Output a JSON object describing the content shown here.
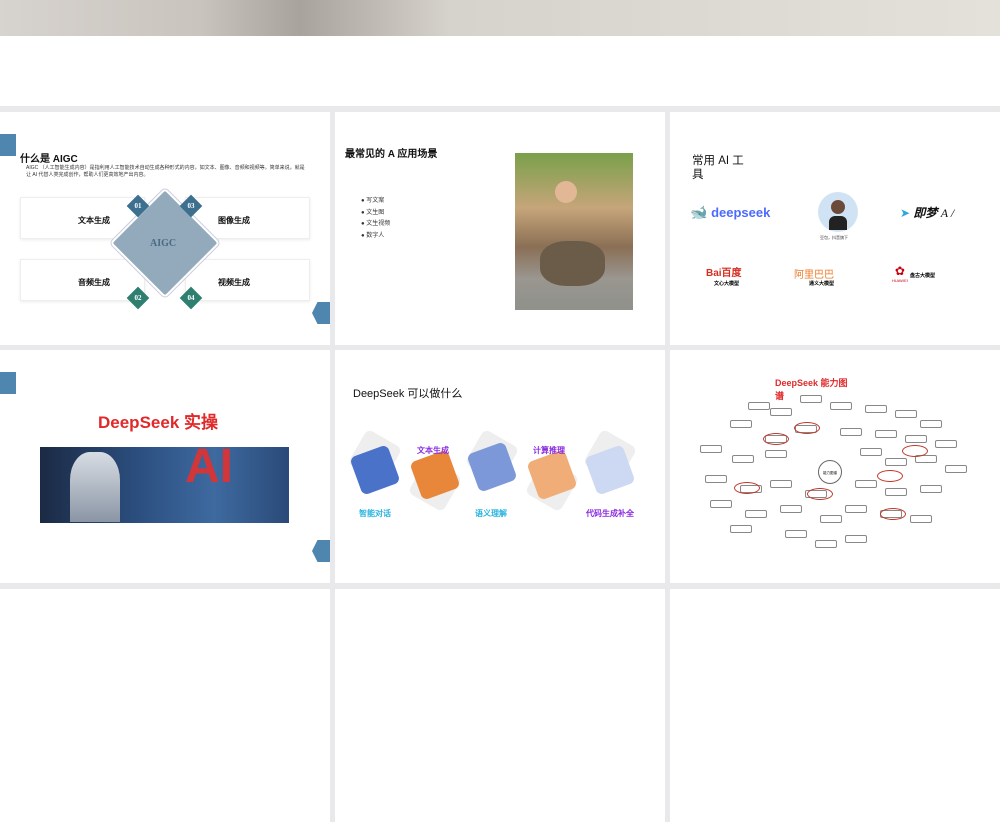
{
  "slides": [
    {
      "title": "什么是 AIGC",
      "body": "AIGC （人工智能生成内容）是指利用人工智能技术自动生成各种形式的内容，如文本、图像、音频和视频等。简单来说，就是让 AI 代替人类完成创作，帮助人们更高效地产出内容。",
      "center": "AIGC",
      "items": [
        {
          "num": "01",
          "label": "文本生成"
        },
        {
          "num": "02",
          "label": "音频生成"
        },
        {
          "num": "03",
          "label": "图像生成"
        },
        {
          "num": "04",
          "label": "视频生成"
        }
      ]
    },
    {
      "title": "最常见的 A 应用场景",
      "bullets": [
        "写文案",
        "文生图",
        "文生视频",
        "数字人"
      ]
    },
    {
      "title": "常用 AI 工具",
      "tools": [
        {
          "logo": "deepseek"
        },
        {
          "caption": "豆包，抖音旗下"
        },
        {
          "logo": "即梦",
          "suffix": "A /"
        },
        {
          "logo": "Bai百度",
          "caption": "文心大模型"
        },
        {
          "logo": "阿里巴巴",
          "caption": "通义大模型"
        },
        {
          "logo": "HUAWEI",
          "caption": "盘古大模型"
        }
      ]
    },
    {
      "title": "DeepSeek 实操",
      "image_text": "AI"
    },
    {
      "title": "DeepSeek 可以做什么",
      "features": [
        "智能对话",
        "文本生成",
        "语义理解",
        "计算推理",
        "代码生成补全"
      ],
      "colors": {
        "blue": "#4a72c9",
        "orange": "#e8873a",
        "lightblue": "#7d98d8",
        "peach": "#f0ad77",
        "pale": "#cdd8f2",
        "cyan": "#2bb4e0",
        "purple": "#8a2be2"
      }
    },
    {
      "title": "DeepSeek 能力图谱",
      "center": "能力图谱"
    }
  ]
}
